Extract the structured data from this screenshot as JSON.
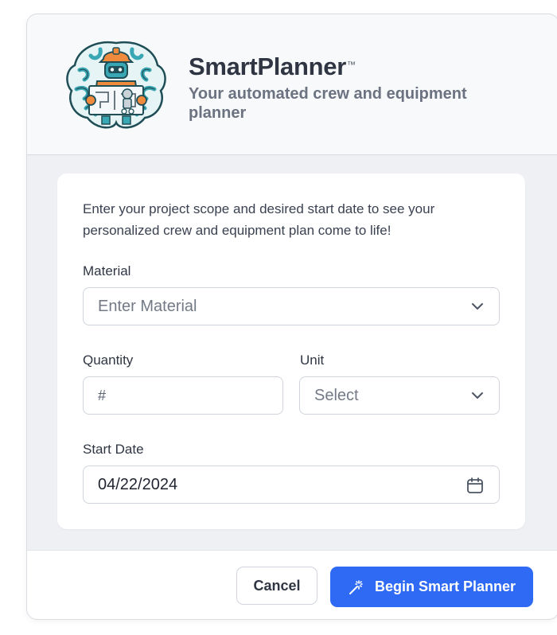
{
  "header": {
    "app_name": "SmartPlanner",
    "trademark": "™",
    "subtitle": "Your automated crew and equipment planner"
  },
  "form": {
    "intro": "Enter your project scope and desired start date to see your personalized crew and equipment plan come to life!",
    "material": {
      "label": "Material",
      "placeholder": "Enter Material"
    },
    "quantity": {
      "label": "Quantity",
      "placeholder": "#"
    },
    "unit": {
      "label": "Unit",
      "placeholder": "Select"
    },
    "start_date": {
      "label": "Start Date",
      "value": "04/22/2024"
    }
  },
  "footer": {
    "cancel_label": "Cancel",
    "primary_label": "Begin Smart Planner"
  },
  "colors": {
    "primary": "#2f6af4",
    "logo_teal": "#3aa7b4",
    "logo_orange": "#f08a3c"
  },
  "icons": {
    "logo": "construction-robot-brain-logo",
    "material_dropdown": "chevron-down-icon",
    "unit_dropdown": "chevron-down-icon",
    "date": "calendar-icon",
    "primary_button": "magic-wand-icon"
  }
}
